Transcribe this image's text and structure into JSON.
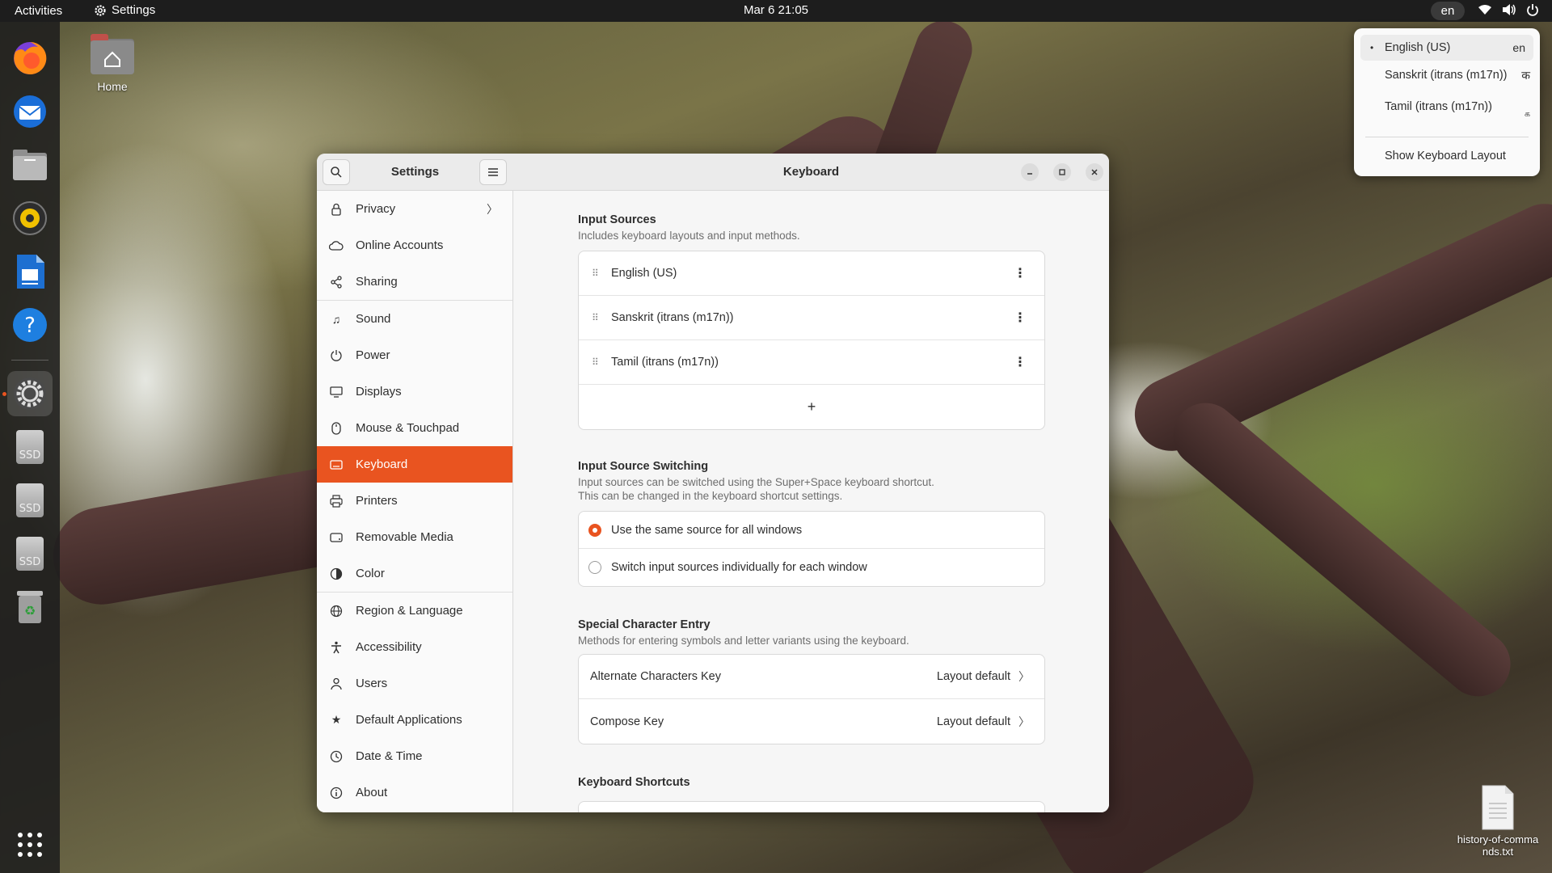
{
  "topbar": {
    "activities": "Activities",
    "app_name": "Settings",
    "clock": "Mar 6  21:05",
    "lang": "en"
  },
  "desktop": {
    "home_label": "Home",
    "file_label": "history-of-commands.txt"
  },
  "dock": {
    "ssd1": "SSD",
    "ssd2": "SSD",
    "ssd3": "SSD"
  },
  "window": {
    "sidebar_title": "Settings",
    "page_title": "Keyboard",
    "sidebar_items": [
      {
        "label": "Privacy",
        "icon": "lock-icon"
      },
      {
        "label": "Online Accounts",
        "icon": "cloud-icon"
      },
      {
        "label": "Sharing",
        "icon": "share-icon"
      },
      {
        "label": "Sound",
        "icon": "music-note-icon"
      },
      {
        "label": "Power",
        "icon": "power-icon"
      },
      {
        "label": "Displays",
        "icon": "display-icon"
      },
      {
        "label": "Mouse & Touchpad",
        "icon": "mouse-icon"
      },
      {
        "label": "Keyboard",
        "icon": "keyboard-icon"
      },
      {
        "label": "Printers",
        "icon": "printer-icon"
      },
      {
        "label": "Removable Media",
        "icon": "media-icon"
      },
      {
        "label": "Color",
        "icon": "color-icon"
      },
      {
        "label": "Region & Language",
        "icon": "globe-icon"
      },
      {
        "label": "Accessibility",
        "icon": "accessibility-icon"
      },
      {
        "label": "Users",
        "icon": "user-icon"
      },
      {
        "label": "Default Applications",
        "icon": "star-icon"
      },
      {
        "label": "Date & Time",
        "icon": "clock-icon"
      },
      {
        "label": "About",
        "icon": "info-icon"
      }
    ],
    "active_item": "Keyboard"
  },
  "keyboard": {
    "input_sources": {
      "title": "Input Sources",
      "desc": "Includes keyboard layouts and input methods.",
      "items": [
        "English (US)",
        "Sanskrit (itrans (m17n))",
        "Tamil (itrans (m17n))"
      ],
      "add": "+"
    },
    "switching": {
      "title": "Input Source Switching",
      "desc1": "Input sources can be switched using the Super+Space keyboard shortcut.",
      "desc2": "This can be changed in the keyboard shortcut settings.",
      "options": [
        "Use the same source for all windows",
        "Switch input sources individually for each window"
      ],
      "selected": 0
    },
    "special": {
      "title": "Special Character Entry",
      "desc": "Methods for entering symbols and letter variants using the keyboard.",
      "rows": [
        {
          "label": "Alternate Characters Key",
          "value": "Layout default"
        },
        {
          "label": "Compose Key",
          "value": "Layout default"
        }
      ]
    },
    "shortcuts": {
      "title": "Keyboard Shortcuts"
    }
  },
  "popup": {
    "items": [
      {
        "label": "English (US)",
        "tag": "en"
      },
      {
        "label": "Sanskrit (itrans (m17n))",
        "tag": "क"
      },
      {
        "label": "Tamil (itrans (m17n))",
        "tag": "க"
      }
    ],
    "show_layout": "Show Keyboard Layout"
  },
  "colors": {
    "accent": "#e95420",
    "topbar": "#1d1d1d"
  }
}
